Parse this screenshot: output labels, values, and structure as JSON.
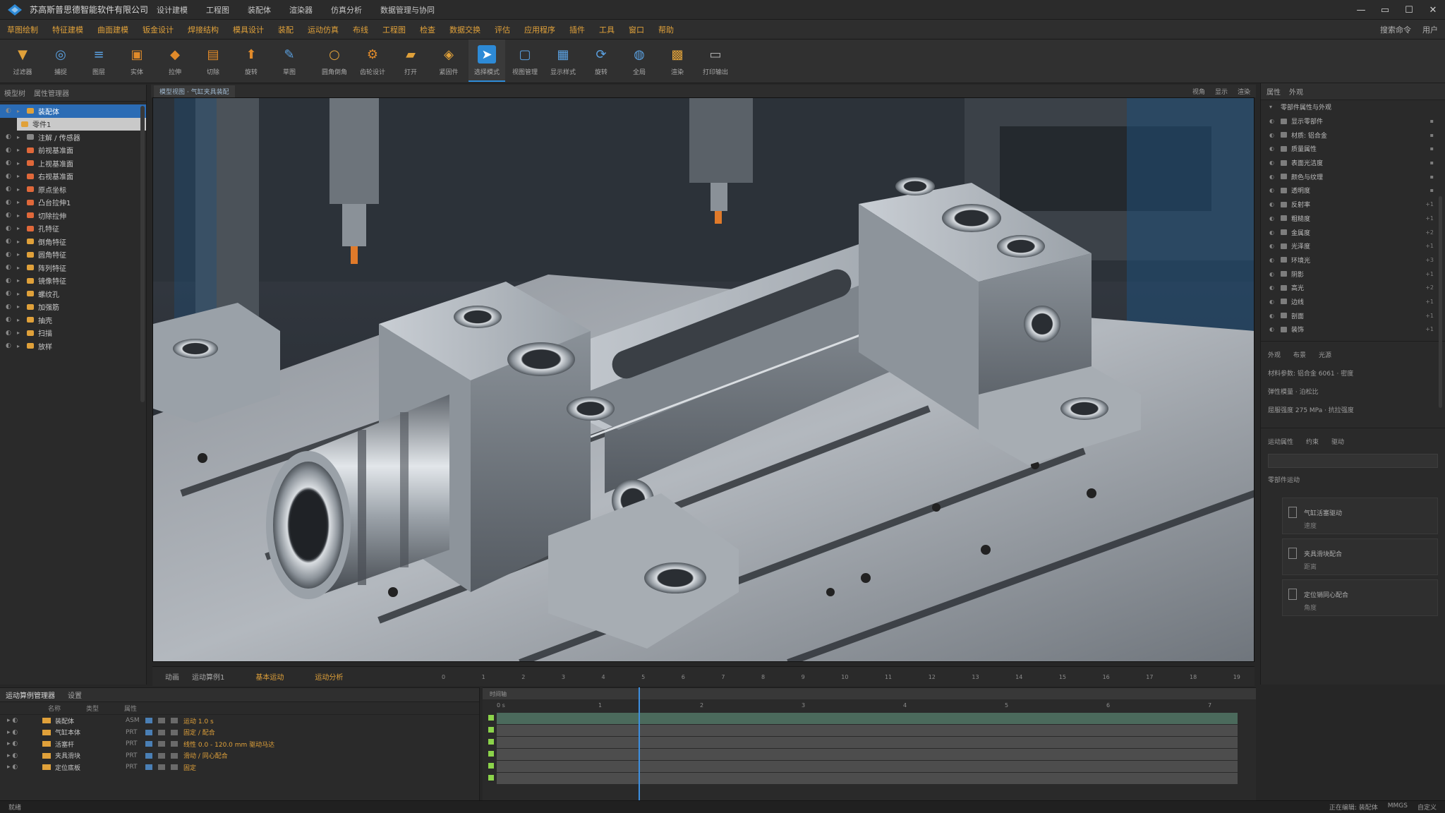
{
  "titlebar": {
    "title": "苏高斯普思德智能软件有限公司",
    "menu": [
      "设计建模",
      "工程图",
      "装配体",
      "渲染器",
      "仿真分析",
      "数据管理与协同"
    ],
    "controls": [
      "—",
      "▭",
      "☐",
      "✕"
    ]
  },
  "menubar": {
    "items": [
      "草图绘制",
      "特征建模",
      "曲面建模",
      "钣金设计",
      "焊接结构",
      "模具设计",
      "装配",
      "运动仿真",
      "布线",
      "工程图",
      "检查",
      "数据交换",
      "评估",
      "应用程序",
      "插件",
      "工具",
      "窗口",
      "帮助"
    ],
    "right": [
      "搜索命令",
      "用户"
    ]
  },
  "toolbar": {
    "tools": [
      {
        "icon": "funnel-icon",
        "label": "过滤器",
        "color": "#e0a13a"
      },
      {
        "icon": "target-icon",
        "label": "捕捉",
        "color": "#5aa0e0"
      },
      {
        "icon": "layers-icon",
        "label": "图层",
        "color": "#5aa0e0"
      },
      {
        "icon": "box-icon",
        "label": "实体",
        "color": "#e08a2a"
      },
      {
        "icon": "diamond-icon",
        "label": "拉伸",
        "color": "#e08a2a"
      },
      {
        "icon": "frame-icon",
        "label": "切除",
        "color": "#e08a2a"
      },
      {
        "icon": "house-icon",
        "label": "旋转",
        "color": "#e08a2a"
      },
      {
        "icon": "pencil-icon",
        "label": "草图",
        "color": "#5aa0e0"
      },
      {
        "icon": "circle-icon",
        "label": "圆角倒角",
        "color": "#e0a13a"
      },
      {
        "icon": "gear-icon",
        "label": "齿轮设计",
        "color": "#e08a2a"
      },
      {
        "icon": "folder-icon",
        "label": "打开",
        "color": "#e0a13a"
      },
      {
        "icon": "bolt-icon",
        "label": "紧固件",
        "color": "#e0a13a"
      },
      {
        "icon": "cursor-icon",
        "label": "选择模式",
        "color": "#ffffff"
      },
      {
        "icon": "screen-icon",
        "label": "视图管理",
        "color": "#5aa0e0"
      },
      {
        "icon": "window-icon",
        "label": "显示样式",
        "color": "#5aa0e0"
      },
      {
        "icon": "rotate-icon",
        "label": "旋转",
        "color": "#5aa0e0"
      },
      {
        "icon": "globe-icon",
        "label": "全局",
        "color": "#5aa0e0"
      },
      {
        "icon": "monitor-icon",
        "label": "渲染",
        "color": "#e0a13a"
      },
      {
        "icon": "printer-icon",
        "label": "打印输出",
        "color": "#b0b0b0"
      }
    ],
    "active_index": 12
  },
  "left_panel": {
    "tabs": [
      "模型树",
      "属性管理器"
    ],
    "items": [
      {
        "label": "装配体",
        "color": "#e0a13a",
        "state": "selected"
      },
      {
        "label": "零件1",
        "color": "#e0a13a",
        "state": "sub"
      },
      {
        "label": "注解 / 传感器",
        "color": "#888888",
        "state": ""
      },
      {
        "label": "前视基准面",
        "color": "#e0683a",
        "state": ""
      },
      {
        "label": "上视基准面",
        "color": "#e0683a",
        "state": ""
      },
      {
        "label": "右视基准面",
        "color": "#e0683a",
        "state": ""
      },
      {
        "label": "原点坐标",
        "color": "#e0683a",
        "state": ""
      },
      {
        "label": "凸台拉伸1",
        "color": "#e0683a",
        "state": ""
      },
      {
        "label": "切除拉伸",
        "color": "#e0683a",
        "state": ""
      },
      {
        "label": "孔特征",
        "color": "#e0683a",
        "state": ""
      },
      {
        "label": "倒角特征",
        "color": "#e0a13a",
        "state": ""
      },
      {
        "label": "圆角特征",
        "color": "#e0a13a",
        "state": ""
      },
      {
        "label": "阵列特征",
        "color": "#e0a13a",
        "state": ""
      },
      {
        "label": "镜像特征",
        "color": "#e0a13a",
        "state": ""
      },
      {
        "label": "螺纹孔",
        "color": "#e0a13a",
        "state": ""
      },
      {
        "label": "加强筋",
        "color": "#e0a13a",
        "state": ""
      },
      {
        "label": "抽壳",
        "color": "#e0a13a",
        "state": ""
      },
      {
        "label": "扫描",
        "color": "#e0a13a",
        "state": ""
      },
      {
        "label": "放样",
        "color": "#e0a13a",
        "state": ""
      }
    ]
  },
  "viewport": {
    "tab": "模型视图 · 气缸夹具装配",
    "tools": [
      "视角",
      "显示",
      "渲染"
    ]
  },
  "timeline_strip": {
    "segments": [
      "动画",
      "运动算例1",
      "基本运动",
      "运动分析"
    ],
    "ticks": [
      "0",
      "1",
      "2",
      "3",
      "4",
      "5",
      "6",
      "7",
      "8",
      "9",
      "10",
      "11",
      "12",
      "13",
      "14",
      "15",
      "16",
      "17",
      "18",
      "19"
    ]
  },
  "right_panel": {
    "tabs": [
      "属性",
      "外观"
    ],
    "title": "零部件属性与外观",
    "rows": [
      {
        "label": "显示零部件",
        "value": "▪"
      },
      {
        "label": "材质: 铝合金",
        "value": "▪"
      },
      {
        "label": "质量属性",
        "value": "▪"
      },
      {
        "label": "表面光洁度",
        "value": "▪"
      },
      {
        "label": "颜色与纹理",
        "value": "▪"
      },
      {
        "label": "透明度",
        "value": "▪"
      },
      {
        "label": "反射率",
        "value": "+1"
      },
      {
        "label": "粗糙度",
        "value": "+1"
      },
      {
        "label": "金属度",
        "value": "+2"
      },
      {
        "label": "光泽度",
        "value": "+1"
      },
      {
        "label": "环境光",
        "value": "+3"
      },
      {
        "label": "阴影",
        "value": "+1"
      },
      {
        "label": "高光",
        "value": "+2"
      },
      {
        "label": "边线",
        "value": "+1"
      },
      {
        "label": "剖面",
        "value": "+1"
      },
      {
        "label": "装饰",
        "value": "+1"
      }
    ],
    "section1": [
      "外观",
      "布景",
      "光源"
    ],
    "section2": [
      "材料参数: 铝合金 6061  ·  密度",
      "弹性模量  ·  泊松比",
      "屈服强度 275 MPa  ·  抗拉强度"
    ],
    "section3_tabs": [
      "运动属性",
      "约束",
      "驱动"
    ],
    "section3_head": "零部件运动",
    "nodes": [
      {
        "title": "气缸活塞驱动",
        "sub": "速度"
      },
      {
        "title": "夹具滑块配合",
        "sub": "距离"
      },
      {
        "title": "定位销同心配合",
        "sub": "角度"
      }
    ]
  },
  "bottom_left": {
    "tabs": [
      "运动算例管理器",
      "设置"
    ],
    "header": [
      "名称",
      "类型",
      "属性"
    ],
    "rows": [
      {
        "name": "装配体",
        "type": "ASM",
        "expr": "运动 1.0 s"
      },
      {
        "name": "气缸本体",
        "type": "PRT",
        "expr": "固定 / 配合"
      },
      {
        "name": "活塞杆",
        "type": "PRT",
        "expr": "线性 0.0 - 120.0 mm 驱动马达"
      },
      {
        "name": "夹具滑块",
        "type": "PRT",
        "expr": "滑动 / 同心配合"
      },
      {
        "name": "定位底板",
        "type": "PRT",
        "expr": "固定"
      }
    ]
  },
  "bottom_right": {
    "ruler_label": "时间轴",
    "ticks": [
      "0 s",
      "1",
      "2",
      "3",
      "4",
      "5",
      "6",
      "7"
    ]
  },
  "statusbar": {
    "left": "就绪",
    "right": [
      "正在编辑: 装配体",
      "MMGS",
      "自定义"
    ]
  }
}
